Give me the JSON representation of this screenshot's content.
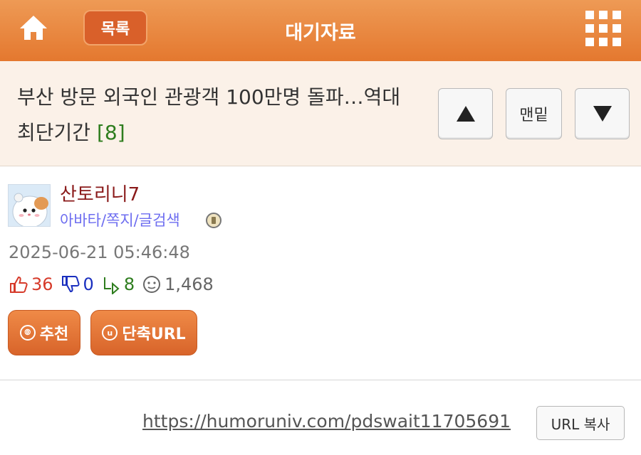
{
  "header": {
    "list_label": "목록",
    "title": "대기자료",
    "home_icon": "home-icon",
    "grid_icon": "grid-menu-icon"
  },
  "post": {
    "title": "부산 방문 외국인 관광객 100만명 돌파…역대 최단기간",
    "reply_count": "[8]",
    "nav": {
      "up_icon": "arrow-up-icon",
      "bottom_label": "맨밑",
      "down_icon": "arrow-down-icon"
    }
  },
  "author": {
    "name": "산토리니7",
    "links": "아바타/쪽지/글검색",
    "avatar_icon": "hamster-avatar",
    "badge_icon": "member-badge-icon"
  },
  "meta": {
    "date": "2025-06-21 05:46:48",
    "upvotes": "36",
    "downvotes": "0",
    "replies": "8",
    "views": "1,468"
  },
  "actions": {
    "recommend_label": "추천",
    "recommend_icon_glyph": "⦾",
    "short_url_label": "단축URL",
    "short_url_icon_glyph": "u"
  },
  "share": {
    "url": "https://humoruniv.com/pdswait11705691",
    "copy_label": "URL 복사"
  },
  "colors": {
    "header": "#e4782f",
    "title_bg": "#fbf1e8",
    "author": "#8a1a1a",
    "links": "#6e6ef0",
    "reply": "#2e7d1e",
    "upvote": "#d63a2a",
    "downvote": "#1a2fbf"
  }
}
